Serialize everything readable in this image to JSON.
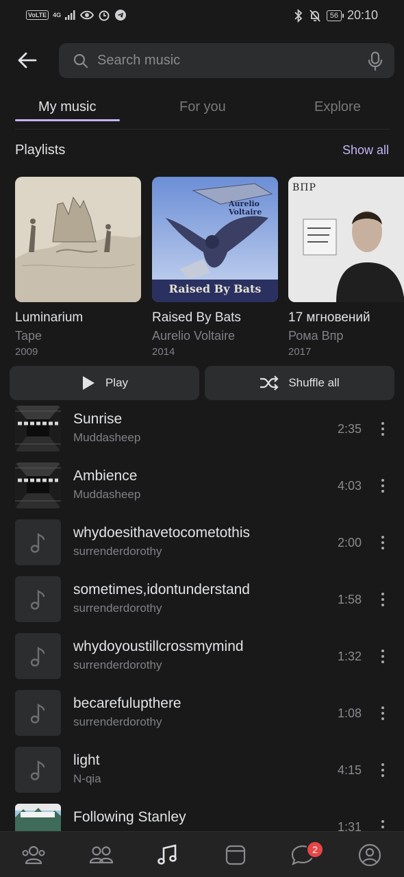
{
  "status_bar": {
    "volte": "VoLTE",
    "network": "4G",
    "battery": "56",
    "time": "20:10"
  },
  "header": {
    "search_placeholder": "Search music"
  },
  "tabs": [
    {
      "label": "My music",
      "active": true
    },
    {
      "label": "For you",
      "active": false
    },
    {
      "label": "Explore",
      "active": false
    }
  ],
  "playlists_section": {
    "title": "Playlists",
    "show_all": "Show all",
    "items": [
      {
        "title": "Luminarium",
        "artist": "Tape",
        "year": "2009"
      },
      {
        "title": "Raised By Bats",
        "artist": "Aurelio Voltaire",
        "year": "2014",
        "cover_text": "Raised By Bats",
        "cover_logo": "Aurelio Voltaire"
      },
      {
        "title": "17 мгновений",
        "artist": "Рома Впр",
        "year": "2017",
        "cover_text": "ВПР"
      }
    ]
  },
  "actions": {
    "play": "Play",
    "shuffle": "Shuffle all"
  },
  "tracks": [
    {
      "title": "Sunrise",
      "artist": "Muddasheep",
      "duration": "2:35",
      "art": "image"
    },
    {
      "title": "Ambience",
      "artist": "Muddasheep",
      "duration": "4:03",
      "art": "image"
    },
    {
      "title": "whydoesithavetocometothis",
      "artist": "surrenderdorothy",
      "duration": "2:00",
      "art": "placeholder"
    },
    {
      "title": "sometimes,idontunderstand",
      "artist": "surrenderdorothy",
      "duration": "1:58",
      "art": "placeholder"
    },
    {
      "title": "whydoyoustillcrossmymind",
      "artist": "surrenderdorothy",
      "duration": "1:32",
      "art": "placeholder"
    },
    {
      "title": "becarefulupthere",
      "artist": "surrenderdorothy",
      "duration": "1:08",
      "art": "placeholder"
    },
    {
      "title": "light",
      "artist": "N-qia",
      "duration": "4:15",
      "art": "placeholder"
    },
    {
      "title": "Following Stanley",
      "artist": "",
      "duration": "1:31",
      "art": "image"
    }
  ],
  "bottom_nav": {
    "items": [
      "friends-icon",
      "communities-icon",
      "music-icon",
      "services-icon",
      "messages-icon",
      "profile-icon"
    ],
    "active": "music-icon",
    "messages_badge": "2"
  },
  "colors": {
    "background": "#19191a",
    "accent": "#c4b5f4",
    "surface": "#2c2d2e",
    "badge": "#e64646"
  }
}
